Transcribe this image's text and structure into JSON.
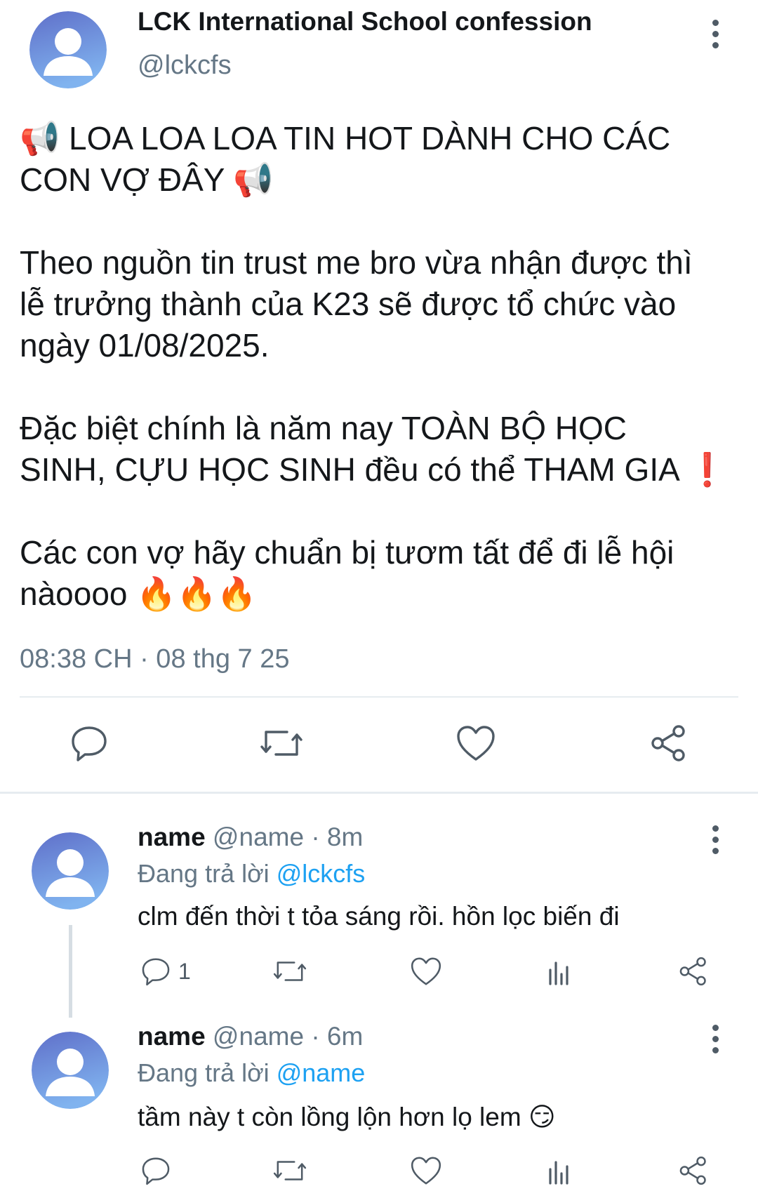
{
  "main_tweet": {
    "author_name": "LCK International School confession",
    "handle": "@lckcfs",
    "lines": [
      "📢 LOA LOA LOA TIN HOT DÀNH CHO CÁC",
      "CON VỢ ĐÂY 📢",
      "Theo nguồn tin trust me bro vừa nhận được thì",
      "lễ trưởng thành của K23 sẽ được tổ chức vào",
      "ngày 01/08/2025.",
      "Đặc biệt chính là năm nay TOÀN BỘ HỌC",
      "SINH, CỰU HỌC SINH đều có thể THAM GIA ❗",
      "Các con vợ hãy chuẩn bị tươm tất để đi lễ hội",
      "nàoooo 🔥🔥🔥"
    ],
    "timestamp": "08:38 CH · 08 thg 7 25",
    "actions": [
      "reply-icon",
      "retweet-icon",
      "like-icon",
      "share-icon"
    ]
  },
  "replies": [
    {
      "name": "name",
      "meta": " @name · 8m",
      "replying_prefix": "Đang trả lời ",
      "replying_to": "@lckcfs",
      "text": "clm đến thời t tỏa sáng rồi. hồn lọc biến đi",
      "reply_count": "1"
    },
    {
      "name": "name",
      "meta": " @name · 6m",
      "replying_prefix": "Đang trả lời ",
      "replying_to": "@name",
      "text": "tầm này t còn lồng lộn hơn lọ lem 😏",
      "reply_count": ""
    }
  ],
  "colors": {
    "text": "#14171a",
    "muted": "#657786",
    "link": "#1da1f2",
    "icon": "#4f5b66",
    "avatar_top": "#5f6fc9",
    "avatar_bottom": "#7fb0ee"
  }
}
